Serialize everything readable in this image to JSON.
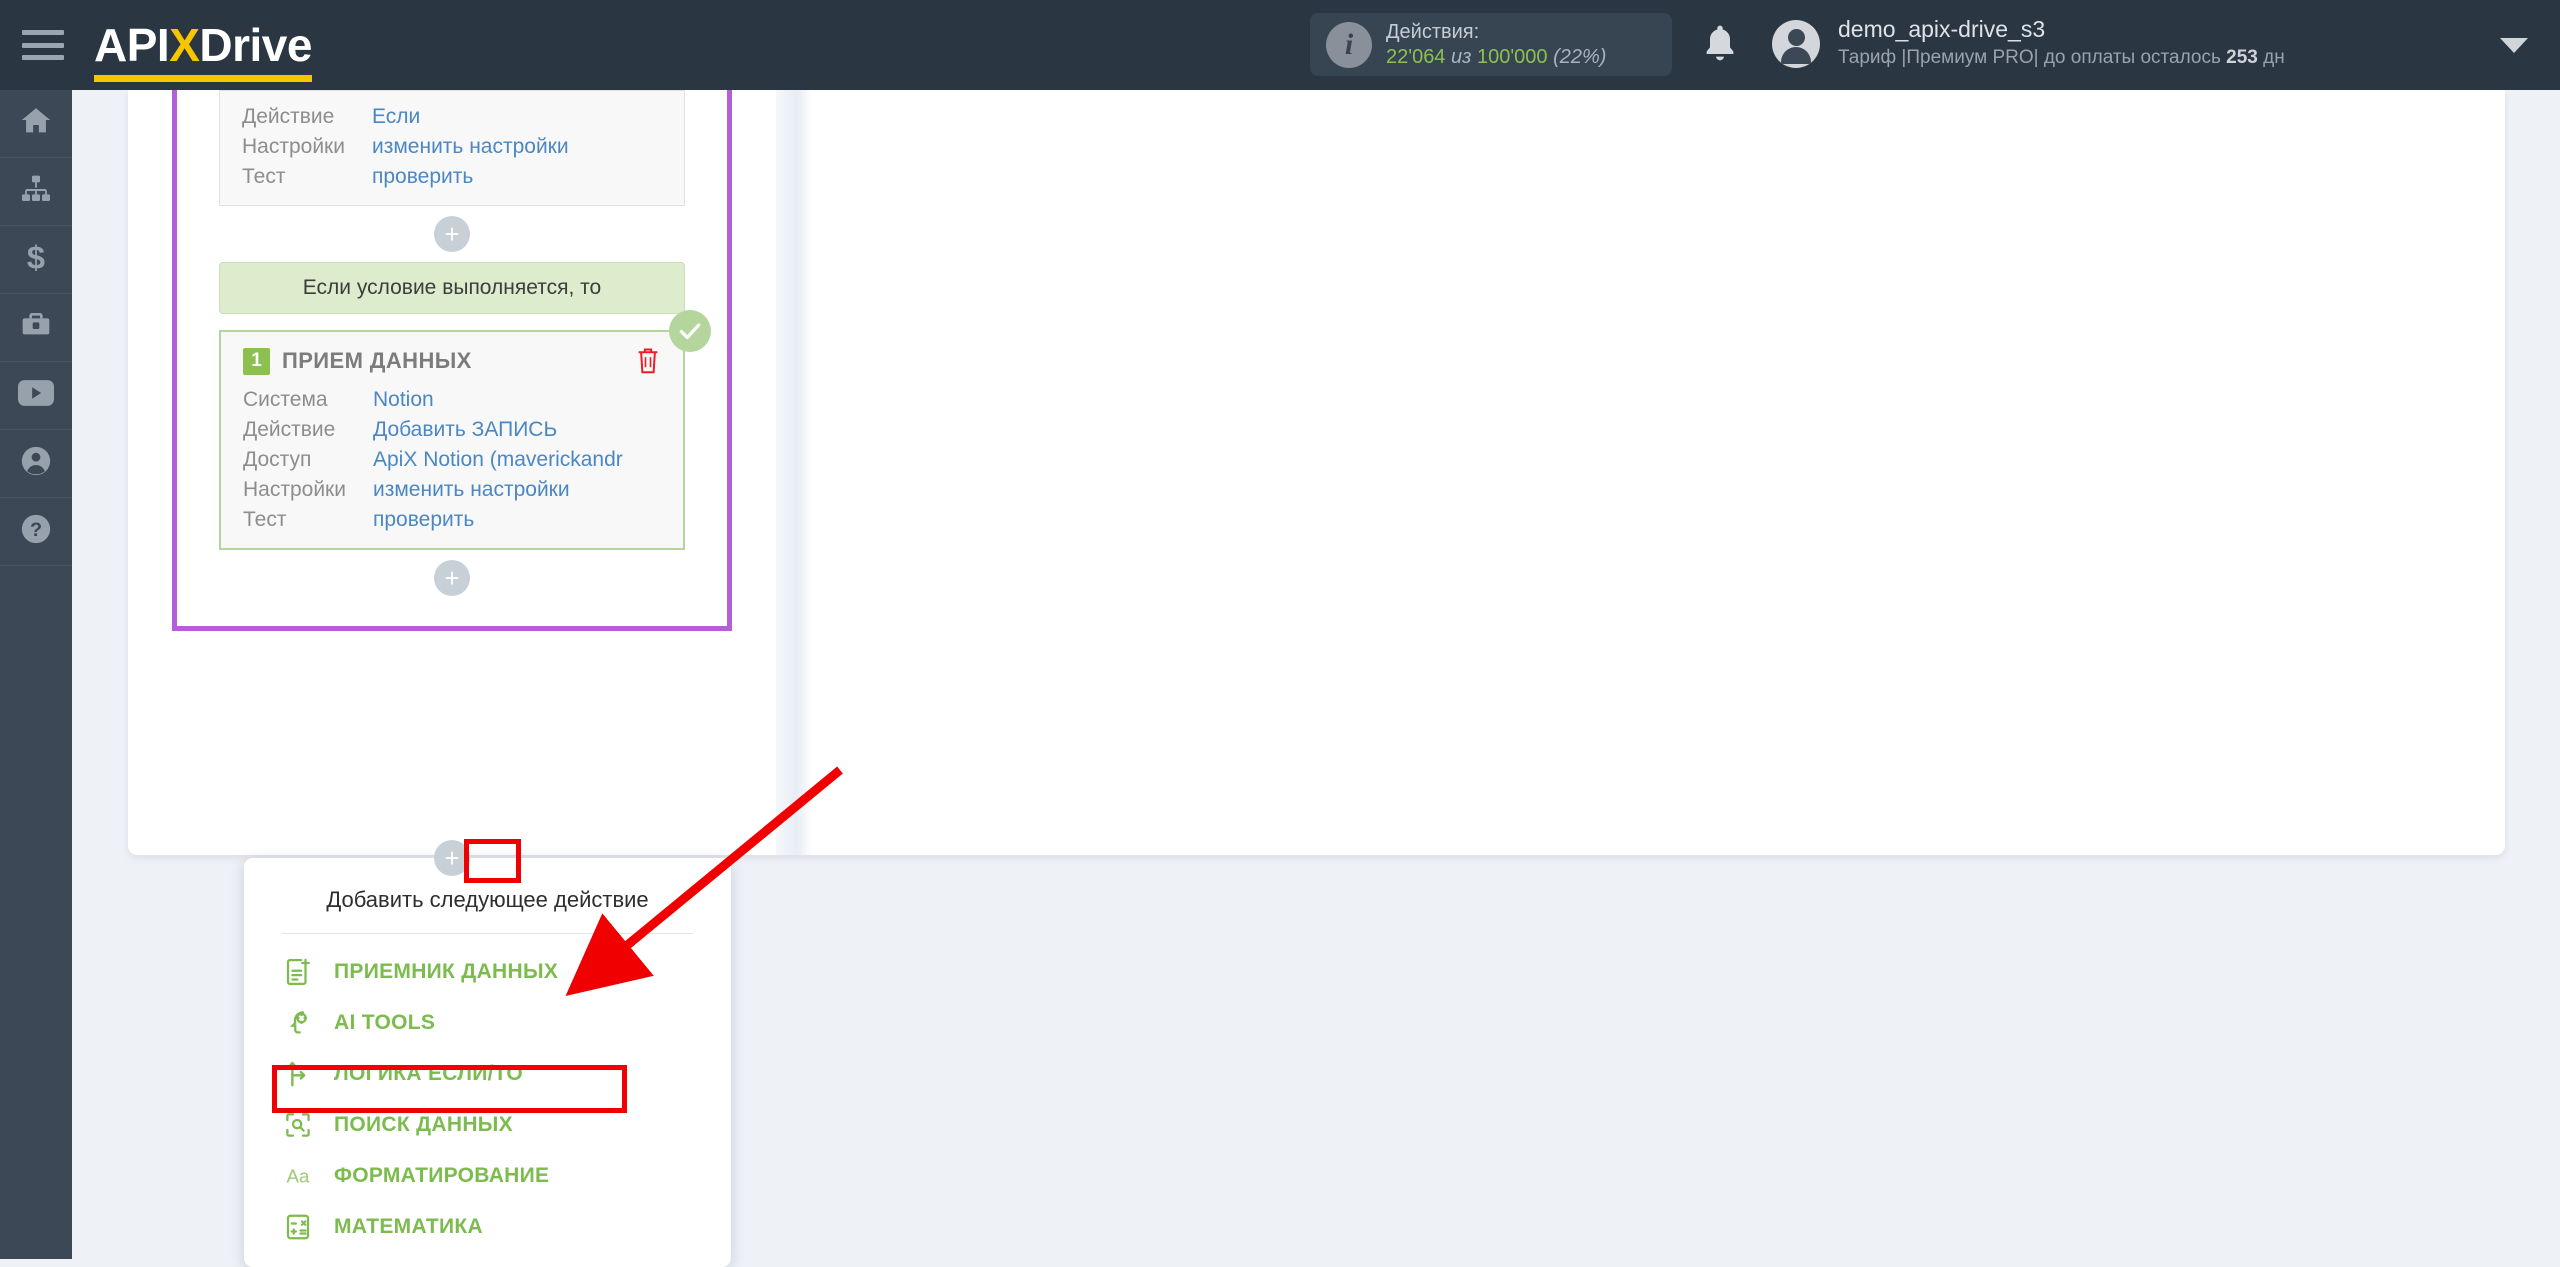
{
  "header": {
    "menu_icon": "hamburger-menu-icon",
    "logo_text_1": "API",
    "logo_text_x": "X",
    "logo_text_2": "Drive",
    "actions": {
      "info_icon": "info-icon",
      "label": "Действия:",
      "used": "22'064",
      "of": "из",
      "total": "100'000",
      "percent": "(22%)"
    },
    "bell_icon": "bell-icon",
    "avatar_icon": "user-avatar-icon",
    "user_name": "demo_apix-drive_s3",
    "plan_prefix": "Тариф |Премиум PRO| до оплаты осталось ",
    "plan_days": "253",
    "plan_suffix": " дн",
    "caret_icon": "chevron-down-icon"
  },
  "sidebar": {
    "items": [
      {
        "icon": "home-icon",
        "name": "sidebar-item-home"
      },
      {
        "icon": "connections-icon",
        "name": "sidebar-item-connections"
      },
      {
        "icon": "dollar-icon",
        "name": "sidebar-item-billing"
      },
      {
        "icon": "briefcase-icon",
        "name": "sidebar-item-business"
      },
      {
        "icon": "youtube-icon",
        "name": "sidebar-item-video"
      },
      {
        "icon": "user-circle-icon",
        "name": "sidebar-item-profile"
      },
      {
        "icon": "help-icon",
        "name": "sidebar-item-help"
      }
    ]
  },
  "flow": {
    "if_card": {
      "rows": [
        {
          "key": "Действие",
          "value": "Если"
        },
        {
          "key": "Настройки",
          "value": "изменить настройки"
        },
        {
          "key": "Тест",
          "value": "проверить"
        }
      ]
    },
    "plus_label": "+",
    "condition_bar": "Если условие выполняется, то",
    "receiver_card": {
      "step": "1",
      "title": "ПРИЕМ ДАННЫХ",
      "delete_icon": "trash-icon",
      "status_icon": "check-circle-icon",
      "rows": [
        {
          "key": "Система",
          "value": "Notion"
        },
        {
          "key": "Действие",
          "value": "Добавить ЗАПИСЬ"
        },
        {
          "key": "Доступ",
          "value": "ApiX Notion (maverickandr"
        },
        {
          "key": "Настройки",
          "value": "изменить настройки"
        },
        {
          "key": "Тест",
          "value": "проверить"
        }
      ]
    }
  },
  "dropdown": {
    "title": "Добавить следующее действие",
    "items": [
      {
        "icon": "document-add-icon",
        "label": "ПРИЕМНИК ДАННЫХ",
        "highlighted": false
      },
      {
        "icon": "ai-brain-icon",
        "label": "AI TOOLS",
        "highlighted": false
      },
      {
        "icon": "branch-logic-icon",
        "label": "ЛОГИКА ЕСЛИ/ТО",
        "highlighted": true
      },
      {
        "icon": "search-data-icon",
        "label": "ПОИСК ДАННЫХ",
        "highlighted": false
      },
      {
        "icon": "text-format-icon",
        "label": "ФОРМАТИРОВАНИЕ",
        "highlighted": false
      },
      {
        "icon": "calculator-icon",
        "label": "МАТЕМАТИКА",
        "highlighted": false
      }
    ]
  },
  "annotations": {
    "highlight_color": "#f00000",
    "arrow_color": "#f00000",
    "branch_color": "#b45fd8",
    "accent_green": "#7cbb4e"
  }
}
